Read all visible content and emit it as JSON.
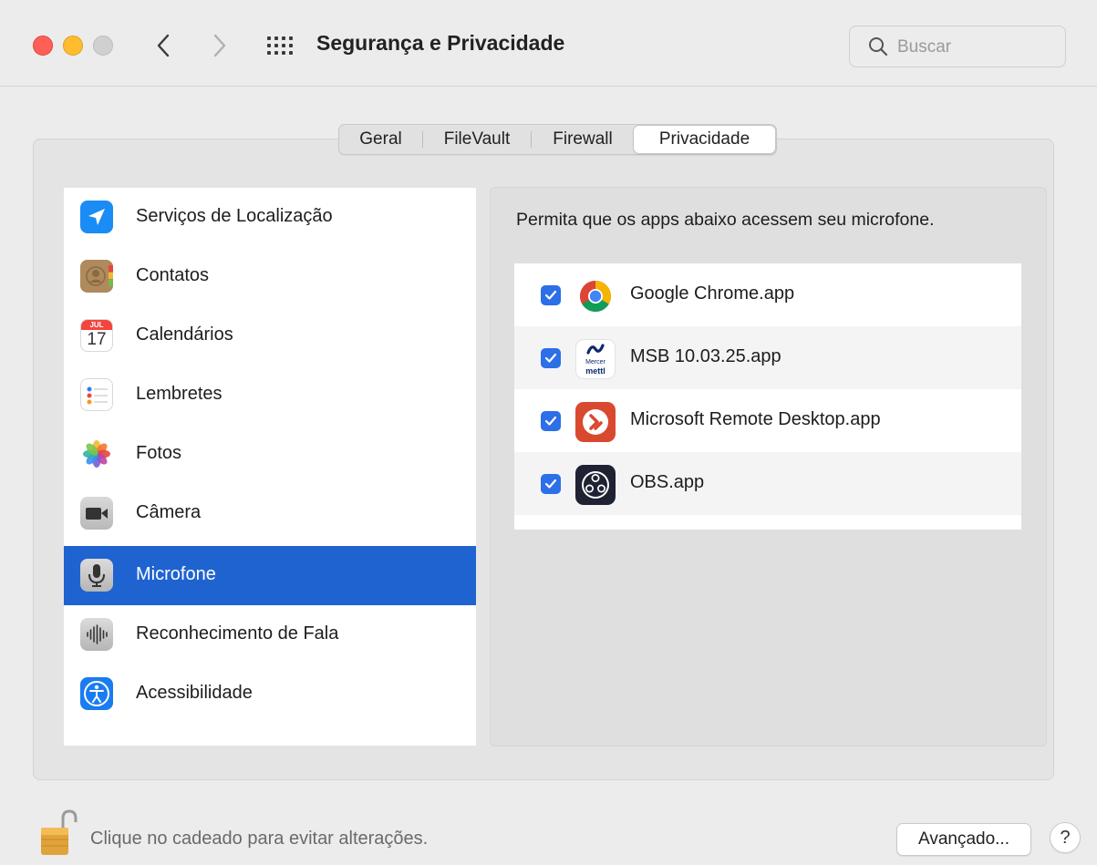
{
  "window": {
    "title": "Segurança e Privacidade",
    "search_placeholder": "Buscar"
  },
  "tabs": [
    {
      "label": "Geral",
      "active": false
    },
    {
      "label": "FileVault",
      "active": false
    },
    {
      "label": "Firewall",
      "active": false
    },
    {
      "label": "Privacidade",
      "active": true
    }
  ],
  "sidebar": {
    "items": [
      {
        "label": "Serviços de Localização",
        "icon": "location-icon",
        "selected": false
      },
      {
        "label": "Contatos",
        "icon": "contacts-icon",
        "selected": false
      },
      {
        "label": "Calendários",
        "icon": "calendar-icon",
        "selected": false,
        "icon_month": "JUL",
        "icon_day": "17"
      },
      {
        "label": "Lembretes",
        "icon": "reminders-icon",
        "selected": false
      },
      {
        "label": "Fotos",
        "icon": "photos-icon",
        "selected": false
      },
      {
        "label": "Câmera",
        "icon": "camera-icon",
        "selected": false
      },
      {
        "label": "Microfone",
        "icon": "microphone-icon",
        "selected": true
      },
      {
        "label": "Reconhecimento de Fala",
        "icon": "speech-recognition-icon",
        "selected": false
      },
      {
        "label": "Acessibilidade",
        "icon": "accessibility-icon",
        "selected": false
      }
    ]
  },
  "detail": {
    "description": "Permita que os apps abaixo acessem seu microfone.",
    "apps": [
      {
        "label": "Google Chrome.app",
        "checked": true,
        "icon": "chrome-icon"
      },
      {
        "label": "MSB 10.03.25.app",
        "checked": true,
        "icon": "msb-mercer-mettl-icon",
        "icon_text_top": "Mercer",
        "icon_text_bottom": "mettl"
      },
      {
        "label": "Microsoft Remote Desktop.app",
        "checked": true,
        "icon": "remote-desktop-icon"
      },
      {
        "label": "OBS.app",
        "checked": true,
        "icon": "obs-icon"
      }
    ]
  },
  "footer": {
    "lock_text": "Clique no cadeado para evitar alterações.",
    "advanced_label": "Avançado...",
    "help_label": "?"
  },
  "colors": {
    "selection": "#1f63d1",
    "checkbox": "#2c6fe6"
  }
}
